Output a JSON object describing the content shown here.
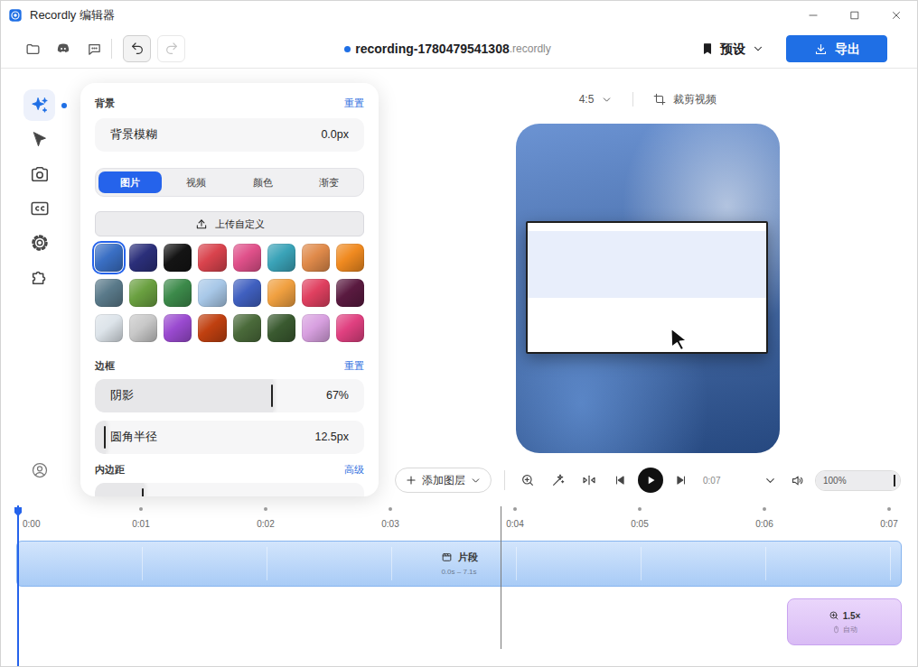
{
  "window": {
    "title": "Recordly 编辑器"
  },
  "toolbar": {
    "undo": {
      "disabled": false
    },
    "redo": {
      "disabled": true
    },
    "file": {
      "name": "recording-1780479541308",
      "extension": ".recordly",
      "unsaved": true
    },
    "preset": {
      "label": "预设"
    },
    "export": {
      "label": "导出"
    }
  },
  "rail": {
    "items": [
      {
        "kind": "effects",
        "selected": true,
        "badge": true
      },
      {
        "kind": "cursor",
        "selected": false,
        "badge": false
      },
      {
        "kind": "camera",
        "selected": false,
        "badge": false
      },
      {
        "kind": "captions",
        "selected": false,
        "badge": false
      },
      {
        "kind": "settings",
        "selected": false,
        "badge": false
      },
      {
        "kind": "extensions",
        "selected": false,
        "badge": false
      }
    ]
  },
  "panel": {
    "background": {
      "title": "背景",
      "reset": "重置",
      "blur": {
        "label": "背景模糊",
        "value": "0.0px"
      },
      "tabs": [
        {
          "label": "图片",
          "selected": true
        },
        {
          "label": "视频",
          "selected": false
        },
        {
          "label": "颜色",
          "selected": false
        },
        {
          "label": "渐变",
          "selected": false
        }
      ],
      "upload": "上传自定义",
      "wallpapers": [
        {
          "color": "#3a6fc4",
          "selected": true
        },
        {
          "color": "#2b2f7a",
          "selected": false
        },
        {
          "color": "#141414",
          "selected": false
        },
        {
          "color": "#d9434d",
          "selected": false
        },
        {
          "color": "#e0508a",
          "selected": false
        },
        {
          "color": "#3aa3b8",
          "selected": false
        },
        {
          "color": "#e08a4a",
          "selected": false
        },
        {
          "color": "#f08a20",
          "selected": false
        },
        {
          "color": "#5a7a8a",
          "selected": false
        },
        {
          "color": "#6aa040",
          "selected": false
        },
        {
          "color": "#3c8a4a",
          "selected": false
        },
        {
          "color": "#a8c8e8",
          "selected": false
        },
        {
          "color": "#4060c0",
          "selected": false
        },
        {
          "color": "#f0a040",
          "selected": false
        },
        {
          "color": "#e04060",
          "selected": false
        },
        {
          "color": "#5a1a40",
          "selected": false
        },
        {
          "color": "#dde4ea",
          "selected": false
        },
        {
          "color": "#c8c8c8",
          "selected": false
        },
        {
          "color": "#9a4ad0",
          "selected": false
        },
        {
          "color": "#c04010",
          "selected": false
        },
        {
          "color": "#4a6a3a",
          "selected": false
        },
        {
          "color": "#3a5a30",
          "selected": false
        },
        {
          "color": "#d8a0e0",
          "selected": false
        },
        {
          "color": "#e04080",
          "selected": false
        }
      ]
    },
    "border": {
      "title": "边框",
      "reset": "重置",
      "sliders": [
        {
          "label": "阴影",
          "value": "67%",
          "level": 0.66
        },
        {
          "label": "圆角半径",
          "value": "12.5px",
          "level": 0.04
        }
      ]
    },
    "padding": {
      "title": "内边距",
      "advanced": "高级",
      "slider": {
        "level": 0.18
      }
    }
  },
  "preview": {
    "aspect": "4:5",
    "crop": "裁剪视频"
  },
  "playback": {
    "add_layer": "添加图层",
    "playing": false,
    "time": "0:07",
    "volume": {
      "value": "100%",
      "level": 1
    }
  },
  "timeline": {
    "ticks": [
      "0:00",
      "0:01",
      "0:02",
      "0:03",
      "0:04",
      "0:05",
      "0:06",
      "0:07"
    ],
    "clip": {
      "label": "片段",
      "range": "0.0s – 7.1s"
    },
    "zoom": {
      "label": "1.5×",
      "mode": "自动"
    }
  }
}
